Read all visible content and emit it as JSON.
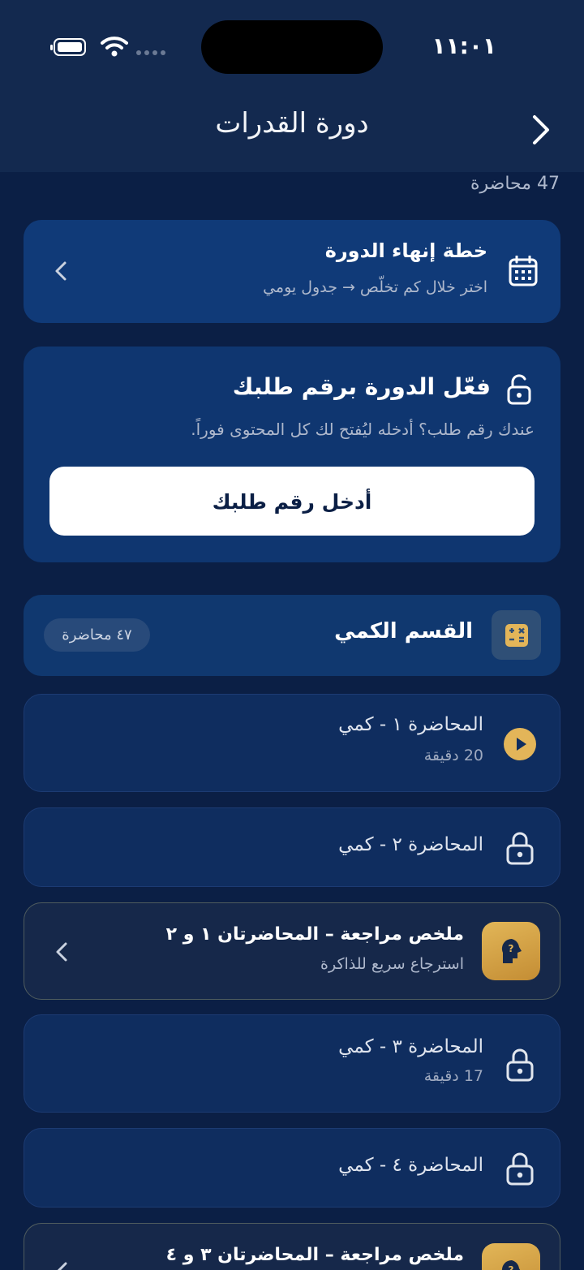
{
  "status_bar": {
    "time": "١١:٠١"
  },
  "nav": {
    "title": "دورة القدرات"
  },
  "lecture_count": "47 محاضرة",
  "plan_card": {
    "title": "خطة إنهاء الدورة",
    "subtitle": "اختر خلال كم تخلّص → جدول يومي"
  },
  "unlock_card": {
    "title": "فعّل الدورة برقم طلبك",
    "subtitle": "عندك رقم طلب؟ أدخله ليُفتح لك كل المحتوى فوراً.",
    "button_label": "أدخل رقم طلبك"
  },
  "section": {
    "title": "القسم الكمي",
    "badge": "٤٧ محاضرة"
  },
  "lessons": [
    {
      "title": "المحاضرة ١ - كمي",
      "duration": "20 دقيقة",
      "state": "playable"
    },
    {
      "title": "المحاضرة ٢ - كمي",
      "duration": "",
      "state": "locked"
    },
    {
      "title": "المحاضرة ٣ - كمي",
      "duration": "17 دقيقة",
      "state": "locked"
    },
    {
      "title": "المحاضرة ٤ - كمي",
      "duration": "",
      "state": "locked"
    }
  ],
  "reviews": [
    {
      "title": "ملخص مراجعة – المحاضرتان ١ و ٢",
      "subtitle": "استرجاع سريع للذاكرة"
    },
    {
      "title": "ملخص مراجعة – المحاضرتان ٣ و ٤",
      "subtitle": ""
    }
  ],
  "colors": {
    "background": "#0b1f45",
    "header": "#13294f",
    "accent_gold": "#e3b559",
    "card_blue": "#103a78"
  }
}
